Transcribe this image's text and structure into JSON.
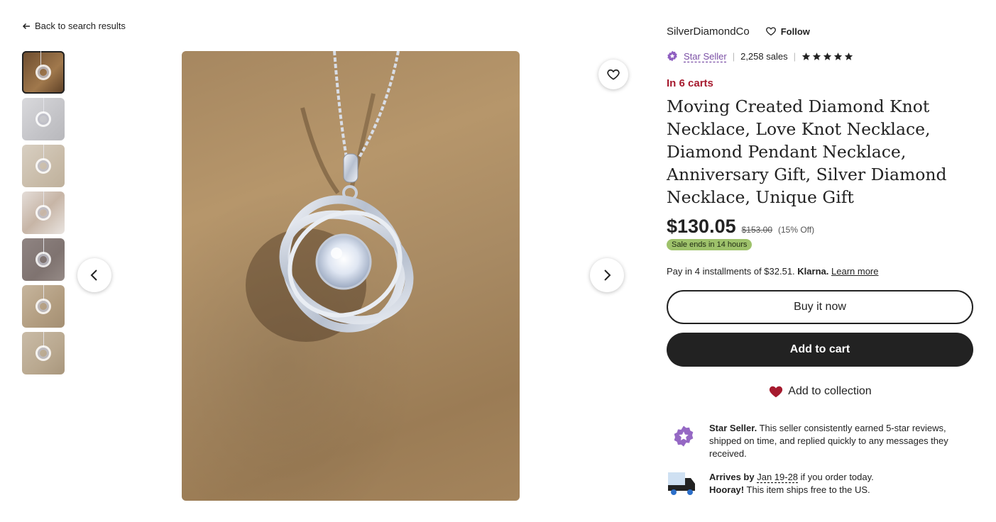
{
  "nav": {
    "back_label": "Back to search results"
  },
  "gallery": {
    "thumbnail_count": 7,
    "active_index": 0
  },
  "shop": {
    "name": "SilverDiamondCo",
    "follow_label": "Follow",
    "star_seller_label": "Star Seller",
    "sales": "2,258 sales",
    "rating": 5
  },
  "listing": {
    "in_carts": "In 6 carts",
    "title": "Moving Created Diamond Knot Necklace, Love Knot Necklace, Diamond Pendant Necklace, Anniversary Gift, Silver Diamond Necklace, Unique Gift",
    "price": "$130.05",
    "original_price": "$153.00",
    "discount": "(15% Off)",
    "sale_badge": "Sale ends in 14 hours"
  },
  "klarna": {
    "text": "Pay in 4 installments of $32.51.",
    "brand": "Klarna.",
    "learn_more": "Learn more"
  },
  "actions": {
    "buy_now": "Buy it now",
    "add_to_cart": "Add to cart",
    "add_to_collection": "Add to collection"
  },
  "info": {
    "star_seller_title": "Star Seller.",
    "star_seller_desc": "This seller consistently earned 5-star reviews, shipped on time, and replied quickly to any messages they received.",
    "arrives_prefix": "Arrives by",
    "arrives_date": "Jan 19-28",
    "arrives_suffix": "if you order today.",
    "hooray": "Hooray!",
    "ships_free": "This item ships free to the US."
  },
  "colors": {
    "accent_purple": "#7b4fa5",
    "carts_red": "#a61a2e",
    "sale_green": "#9ec26b",
    "heart_red": "#a61a2e",
    "primary_dark": "#222222"
  }
}
